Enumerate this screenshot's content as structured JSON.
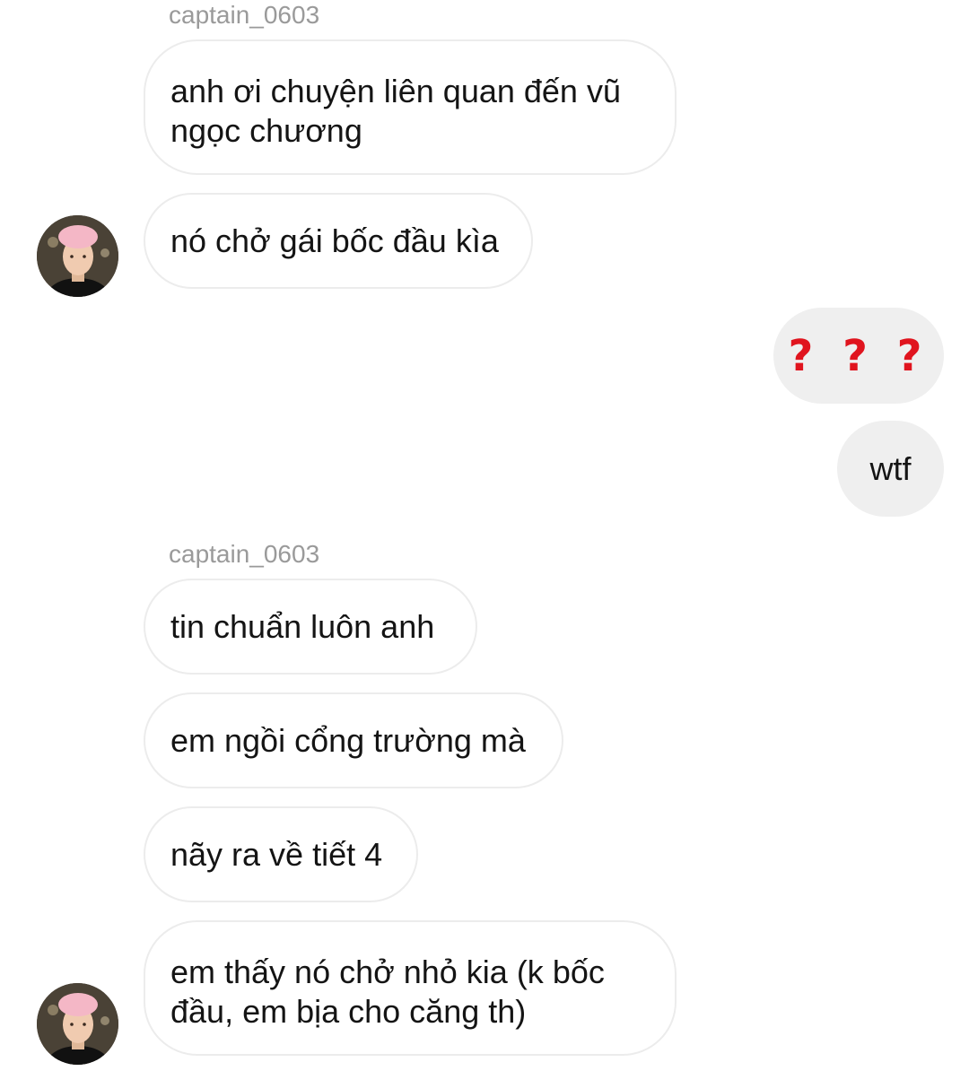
{
  "thread": {
    "groups": [
      {
        "sender": "captain_0603",
        "messages": [
          "anh ơi chuyện liên quan đến vũ\nngọc chương",
          "nó chở gái bốc đầu kìa"
        ]
      },
      {
        "outgoing": [
          "? ? ?",
          "wtf"
        ]
      },
      {
        "sender": "captain_0603",
        "messages": [
          "tin chuẩn luôn anh",
          "em ngồi cổng trường mà",
          "nãy ra về tiết 4",
          "em thấy nó chở nhỏ kia (k bốc\nđầu, em bịa cho căng th)"
        ]
      }
    ]
  },
  "colors": {
    "incoming_bubble_bg": "#ffffff",
    "incoming_bubble_border": "#ececec",
    "outgoing_bubble_bg": "#efefef",
    "sender_name": "#9a9a9a",
    "question_marks": "#e0141e"
  },
  "icons": {
    "avatar": "profile-photo-avatar"
  }
}
